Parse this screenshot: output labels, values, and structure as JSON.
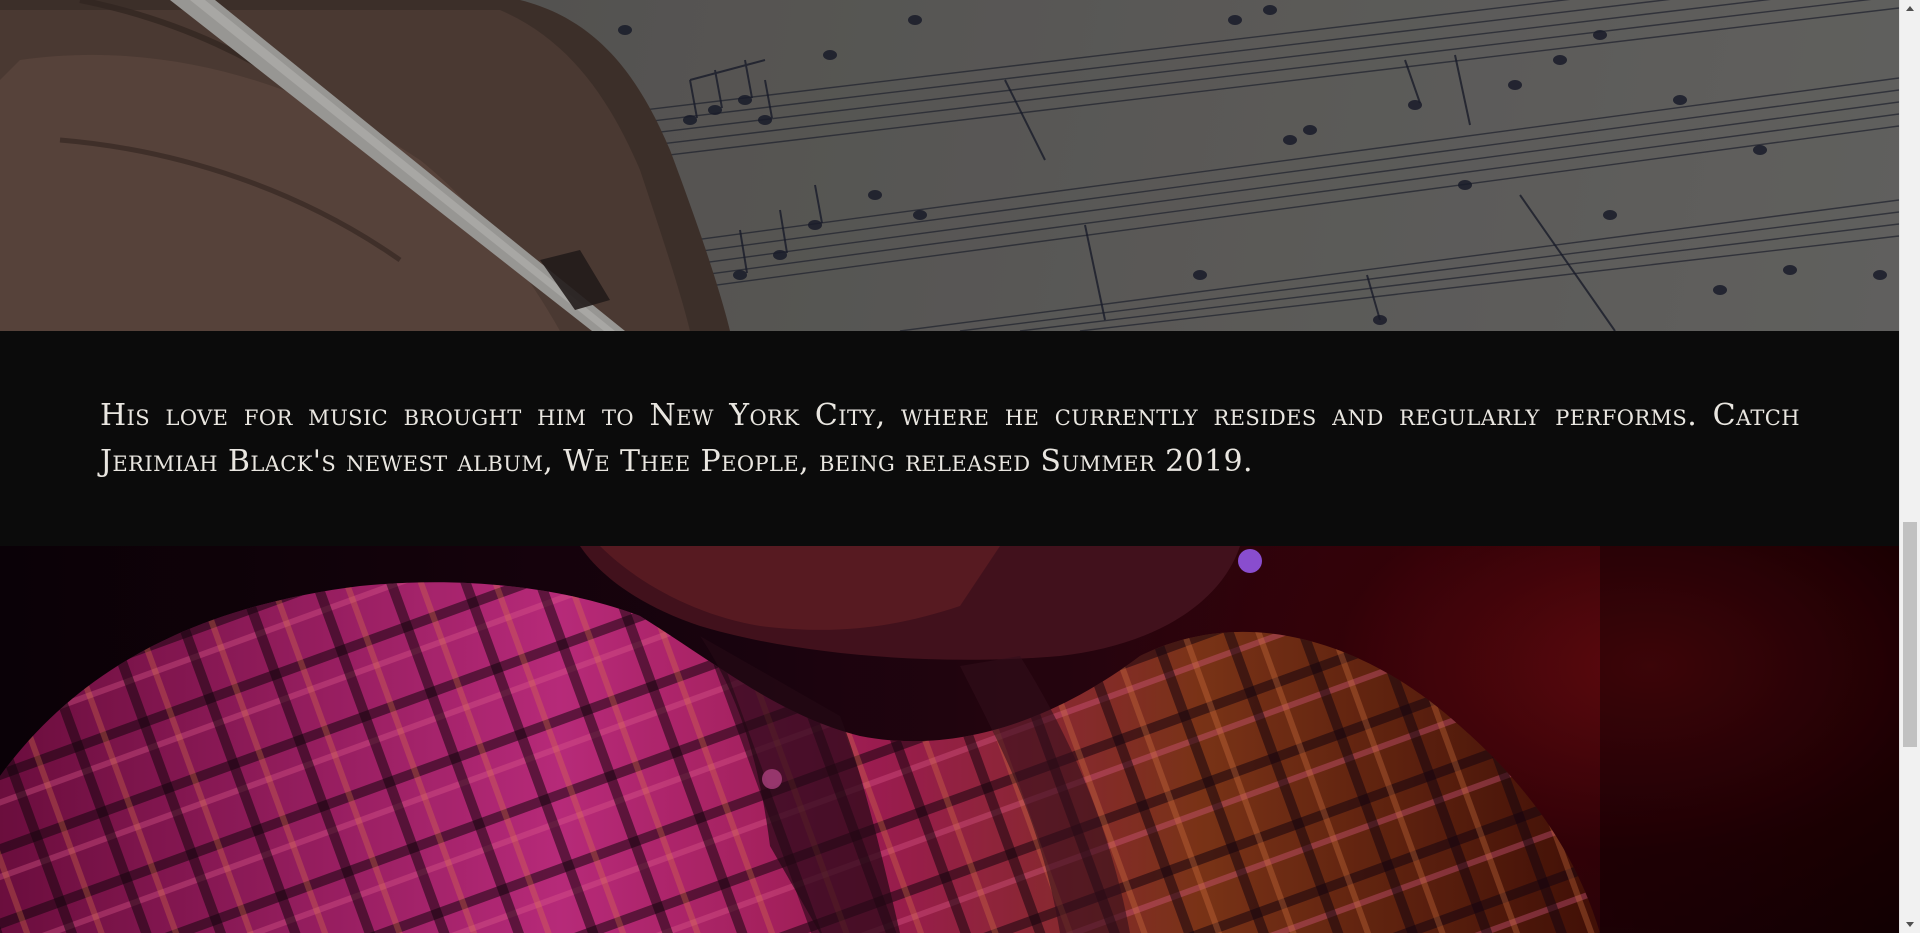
{
  "bio": {
    "text": "His love for music brought him to New York City, where he currently resides and regularly performs. Catch Jerimiah Black's newest album, We Thee People, being released Summer 2019."
  },
  "images": {
    "top": "sheet-music-writing-photo",
    "bottom": "performer-plaid-shirt-photo"
  },
  "colors": {
    "band_background": "#0b0b0b",
    "text": "#e9e6e0"
  },
  "scrollbar": {
    "position_fraction": 0.6
  }
}
